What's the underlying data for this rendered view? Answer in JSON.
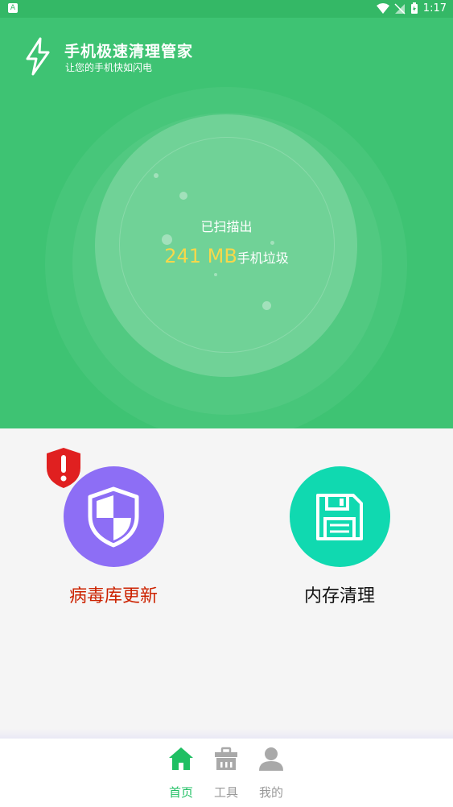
{
  "status_bar": {
    "time": "1:17",
    "left_icon": "A"
  },
  "header": {
    "title": "手机极速清理管家",
    "subtitle": "让您的手机快如闪电"
  },
  "scan": {
    "label": "已扫描出",
    "value": "241 MB",
    "unit": "手机垃圾"
  },
  "tools": [
    {
      "label": "病毒库更新",
      "icon": "shield-icon",
      "color": "#8d6ef5",
      "label_color": "#cc2200"
    },
    {
      "label": "内存清理",
      "icon": "floppy-disk-icon",
      "color": "#10d9b0",
      "label_color": "#111111"
    }
  ],
  "bottom_nav": [
    {
      "label": "首页",
      "icon": "home-icon",
      "active": true
    },
    {
      "label": "工具",
      "icon": "toolbox-icon",
      "active": false
    },
    {
      "label": "我的",
      "icon": "user-icon",
      "active": false
    }
  ],
  "colors": {
    "primary": "#3ec373",
    "accent_value": "#f7d84a",
    "alert": "#e02020"
  }
}
